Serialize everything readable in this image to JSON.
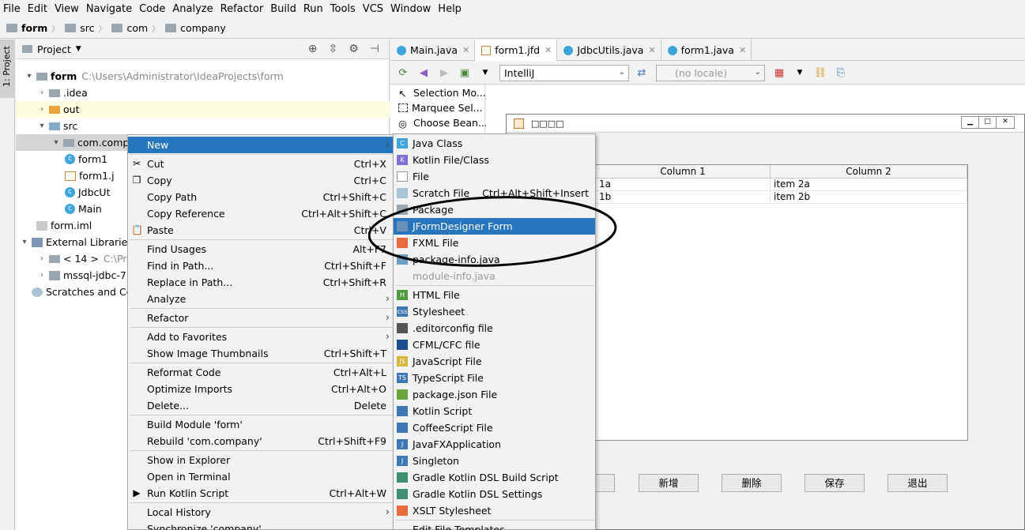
{
  "menubar": [
    "File",
    "Edit",
    "View",
    "Navigate",
    "Code",
    "Analyze",
    "Refactor",
    "Build",
    "Run",
    "Tools",
    "VCS",
    "Window",
    "Help"
  ],
  "breadcrumb": [
    "form",
    "src",
    "com",
    "company"
  ],
  "sidestripe": {
    "tab_label": "1: Project"
  },
  "project_panel": {
    "title": "Project",
    "tree": [
      {
        "label": "form",
        "path": "C:\\Users\\Administrator\\IdeaProjects\\form",
        "icon": "folder-icon",
        "arrow": "▾"
      },
      {
        "label": ".idea",
        "icon": "folder-icon",
        "arrow": "›"
      },
      {
        "label": "out",
        "icon": "folder-orange-icon",
        "arrow": "›"
      },
      {
        "label": "src",
        "icon": "folder-blue-icon",
        "arrow": "▾"
      },
      {
        "label": "com.company",
        "icon": "package-icon",
        "arrow": "▾"
      },
      {
        "label": "form1",
        "icon": "class-icon"
      },
      {
        "label": "form1.j",
        "icon": "form-file-icon"
      },
      {
        "label": "JdbcUt",
        "icon": "class-icon"
      },
      {
        "label": "Main",
        "icon": "class-icon"
      },
      {
        "label": "form.iml",
        "icon": "iml-file-icon"
      },
      {
        "label": "External Libraries",
        "icon": "library-icon",
        "arrow": "▾"
      },
      {
        "label": "< 14 >",
        "path": "C:\\Pro",
        "icon": "jdk-icon",
        "arrow": "›"
      },
      {
        "label": "mssql-jdbc-7.0",
        "icon": "jar-icon",
        "arrow": "›"
      },
      {
        "label": "Scratches and Co",
        "icon": "scratch-icon"
      }
    ]
  },
  "tabs": [
    {
      "label": "Main.java",
      "icon": "class-icon",
      "active": false
    },
    {
      "label": "form1.jfd",
      "icon": "form-file-icon",
      "active": true
    },
    {
      "label": "JdbcUtils.java",
      "icon": "class-icon",
      "active": false
    },
    {
      "label": "form1.java",
      "icon": "class-icon",
      "active": false
    }
  ],
  "editor_toolbar": {
    "laf_combo": "IntelliJ",
    "locale_combo": "(no locale)"
  },
  "palette": [
    "Selection Mo...",
    "Marquee Sel...",
    "Choose Bean..."
  ],
  "form_window": {
    "title": "□□□□",
    "table": {
      "columns": [
        "Column 1",
        "Column 2"
      ],
      "rows": [
        [
          "1a",
          "item 2a"
        ],
        [
          "1b",
          "item 2b"
        ]
      ]
    },
    "buttons": [
      "新增",
      "删除",
      "保存",
      "退出"
    ]
  },
  "context_menu": [
    {
      "label": "New",
      "submenu": true,
      "highlighted": true
    },
    {
      "sep": true
    },
    {
      "label": "Cut",
      "shortcut": "Ctrl+X",
      "icon": "scissors-icon",
      "glyph": "✂"
    },
    {
      "label": "Copy",
      "shortcut": "Ctrl+C",
      "icon": "copy-icon",
      "glyph": "❐"
    },
    {
      "label": "Copy Path",
      "shortcut": "Ctrl+Shift+C"
    },
    {
      "label": "Copy Reference",
      "shortcut": "Ctrl+Alt+Shift+C"
    },
    {
      "label": "Paste",
      "shortcut": "Ctrl+V",
      "icon": "paste-icon",
      "glyph": "📋"
    },
    {
      "sep": true
    },
    {
      "label": "Find Usages",
      "shortcut": "Alt+F7"
    },
    {
      "label": "Find in Path...",
      "shortcut": "Ctrl+Shift+F"
    },
    {
      "label": "Replace in Path...",
      "shortcut": "Ctrl+Shift+R"
    },
    {
      "label": "Analyze",
      "submenu": true
    },
    {
      "sep": true
    },
    {
      "label": "Refactor",
      "submenu": true
    },
    {
      "sep": true
    },
    {
      "label": "Add to Favorites",
      "submenu": true
    },
    {
      "label": "Show Image Thumbnails",
      "shortcut": "Ctrl+Shift+T"
    },
    {
      "sep": true
    },
    {
      "label": "Reformat Code",
      "shortcut": "Ctrl+Alt+L"
    },
    {
      "label": "Optimize Imports",
      "shortcut": "Ctrl+Alt+O"
    },
    {
      "label": "Delete...",
      "shortcut": "Delete"
    },
    {
      "sep": true
    },
    {
      "label": "Build Module 'form'"
    },
    {
      "label": "Rebuild 'com.company'",
      "shortcut": "Ctrl+Shift+F9"
    },
    {
      "sep": true
    },
    {
      "label": "Show in Explorer"
    },
    {
      "label": "Open in Terminal"
    },
    {
      "label": "Run Kotlin Script",
      "shortcut": "Ctrl+Alt+W",
      "icon": "run-icon",
      "glyph": "▶"
    },
    {
      "sep": true
    },
    {
      "label": "Local History",
      "submenu": true
    },
    {
      "label": "Synchronize 'company'"
    }
  ],
  "new_submenu": [
    {
      "label": "Java Class",
      "icon": "java-class-icon",
      "glyph": "C",
      "color": "#3fa4d8"
    },
    {
      "label": "Kotlin File/Class",
      "icon": "kotlin-icon",
      "glyph": "K",
      "color": "#7f6fd8"
    },
    {
      "label": "File",
      "icon": "file-icon",
      "glyph": "",
      "color": "#ffffff"
    },
    {
      "label": "Scratch File",
      "shortcut": "Ctrl+Alt+Shift+Insert",
      "icon": "scratch-file-icon",
      "glyph": "",
      "color": "#a9c3d6"
    },
    {
      "label": "Package",
      "icon": "package-icon",
      "glyph": "",
      "color": "#9aa7b0"
    },
    {
      "label": "JFormDesigner Form",
      "icon": "jformdesigner-icon",
      "glyph": "",
      "color": "#6a8fb8",
      "highlighted": true
    },
    {
      "label": "FXML File",
      "icon": "fxml-icon",
      "glyph": "",
      "color": "#e86a3d"
    },
    {
      "label": "package-info.java",
      "icon": "java-file-icon",
      "glyph": "",
      "color": "#6a9ec9"
    },
    {
      "label": "module-info.java",
      "disabled": true,
      "glyph": ""
    },
    {
      "sep": true
    },
    {
      "label": "HTML File",
      "icon": "html-icon",
      "glyph": "H",
      "color": "#4e9b3d"
    },
    {
      "label": "Stylesheet",
      "icon": "css-icon",
      "glyph": "css",
      "color": "#3d78b5"
    },
    {
      "label": ".editorconfig file",
      "icon": "editorconfig-icon",
      "glyph": "",
      "color": "#555555"
    },
    {
      "label": "CFML/CFC file",
      "icon": "cfml-icon",
      "glyph": "",
      "color": "#1e4f8c"
    },
    {
      "label": "JavaScript File",
      "icon": "javascript-icon",
      "glyph": "JS",
      "color": "#d6b53b"
    },
    {
      "label": "TypeScript File",
      "icon": "typescript-icon",
      "glyph": "TS",
      "color": "#3d78b5"
    },
    {
      "label": "package.json File",
      "icon": "npm-icon",
      "glyph": "",
      "color": "#6ba53d"
    },
    {
      "label": "Kotlin Script",
      "icon": "kotlin-script-icon",
      "glyph": "",
      "color": "#3d78b5"
    },
    {
      "label": "CoffeeScript File",
      "icon": "coffeescript-icon",
      "glyph": "",
      "color": "#3d78b5"
    },
    {
      "label": "JavaFXApplication",
      "icon": "javafx-icon",
      "glyph": "J",
      "color": "#3d78b5"
    },
    {
      "label": "Singleton",
      "icon": "singleton-icon",
      "glyph": "J",
      "color": "#3d78b5"
    },
    {
      "label": "Gradle Kotlin DSL Build Script",
      "icon": "gradle-icon",
      "glyph": "",
      "color": "#3e8f6e"
    },
    {
      "label": "Gradle Kotlin DSL Settings",
      "icon": "gradle-icon",
      "glyph": "",
      "color": "#3e8f6e"
    },
    {
      "label": "XSLT Stylesheet",
      "icon": "xslt-icon",
      "glyph": "",
      "color": "#e86a3d"
    },
    {
      "sep": true
    },
    {
      "label": "Edit File Templates..."
    }
  ],
  "colors": {
    "highlight": "#2675bf",
    "annotation_ellipse": "#000000"
  }
}
